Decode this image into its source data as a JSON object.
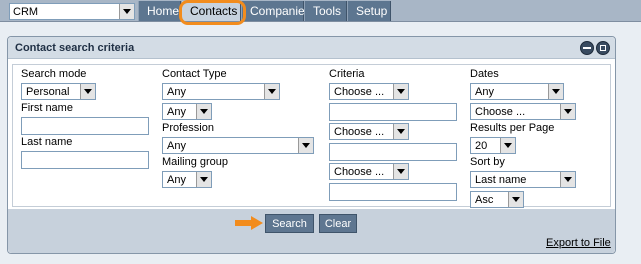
{
  "app_select": {
    "value": "CRM"
  },
  "nav": {
    "tabs": [
      {
        "label": "Home"
      },
      {
        "label": "Contacts",
        "active": true
      },
      {
        "label": "Companies"
      },
      {
        "label": "Tools"
      },
      {
        "label": "Setup"
      }
    ]
  },
  "panel": {
    "title": "Contact search criteria",
    "controls": {
      "minimize_icon": "minimize-icon",
      "maximize_icon": "maximize-icon"
    }
  },
  "form": {
    "search_mode": {
      "label": "Search mode",
      "value": "Personal"
    },
    "first_name": {
      "label": "First name",
      "value": ""
    },
    "last_name": {
      "label": "Last name",
      "value": ""
    },
    "contact_type": {
      "label": "Contact Type",
      "value": "Any",
      "sub_value": "Any"
    },
    "profession": {
      "label": "Profession",
      "value": "Any"
    },
    "mailing_group": {
      "label": "Mailing group",
      "value": "Any"
    },
    "criteria": {
      "label": "Criteria",
      "rows": [
        {
          "select": "Choose ...",
          "text": ""
        },
        {
          "select": "Choose ...",
          "text": ""
        },
        {
          "select": "Choose ...",
          "text": ""
        }
      ]
    },
    "dates": {
      "label": "Dates",
      "value": "Any",
      "sub_value": "Choose ..."
    },
    "results_per_page": {
      "label": "Results per Page",
      "value": "20"
    },
    "sort_by": {
      "label": "Sort by",
      "field": "Last name",
      "order": "Asc"
    }
  },
  "footer": {
    "search_label": "Search",
    "clear_label": "Clear",
    "export_label": "Export to File"
  },
  "colors": {
    "accent_orange": "#f28c1d",
    "nav_tab": "#5d7690",
    "nav_tab_active": "#c7d2de"
  }
}
